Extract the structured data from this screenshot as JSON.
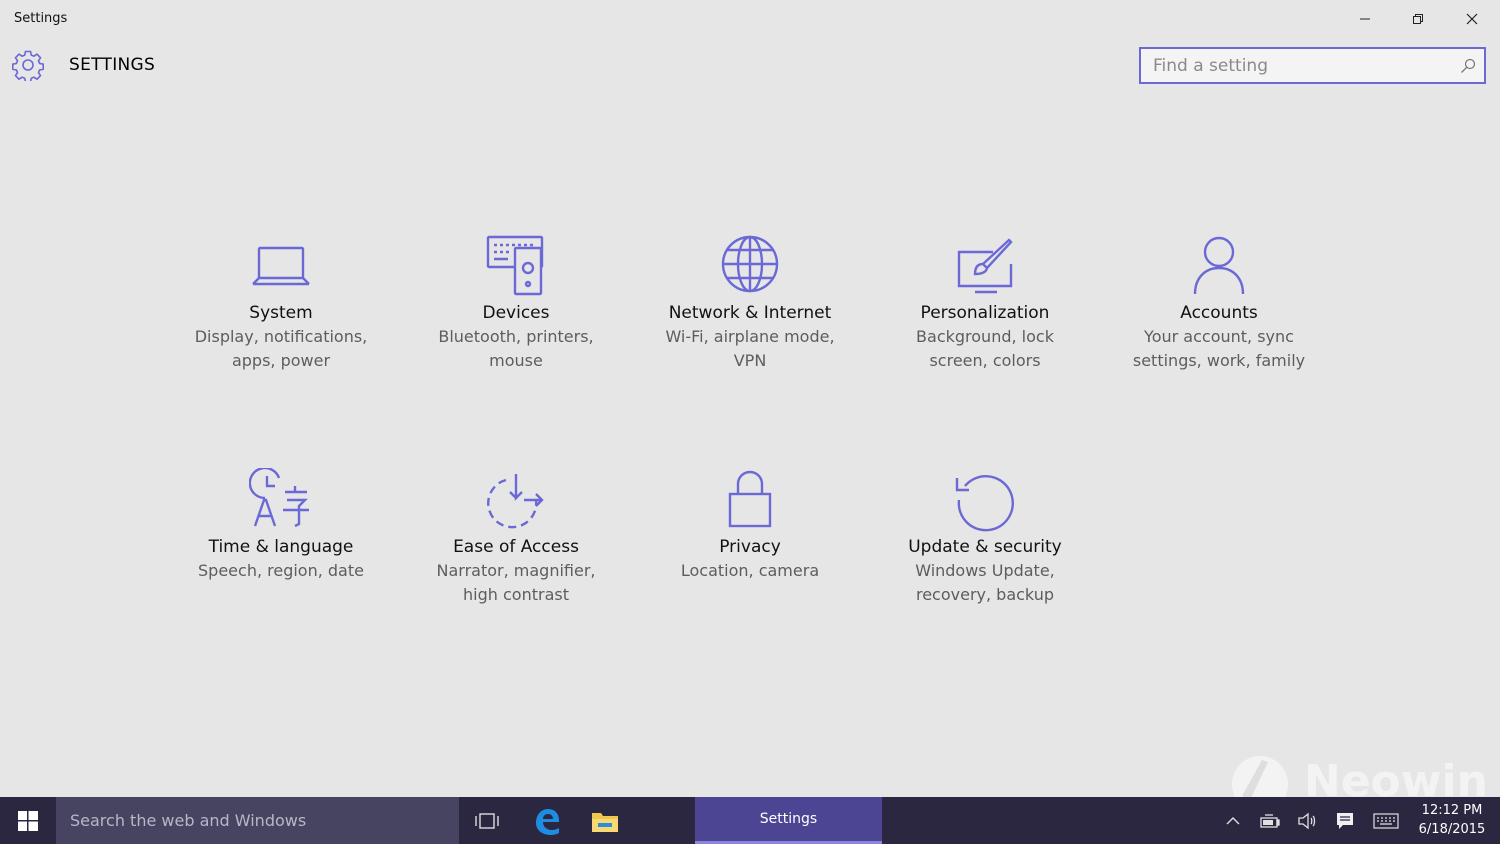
{
  "window": {
    "title": "Settings"
  },
  "header": {
    "title": "SETTINGS",
    "search_placeholder": "Find a setting"
  },
  "tiles": [
    {
      "title": "System",
      "desc": "Display, notifications, apps, power",
      "icon": "laptop-icon"
    },
    {
      "title": "Devices",
      "desc": "Bluetooth, printers, mouse",
      "icon": "devices-icon"
    },
    {
      "title": "Network & Internet",
      "desc": "Wi-Fi, airplane mode, VPN",
      "icon": "globe-icon"
    },
    {
      "title": "Personalization",
      "desc": "Background, lock screen, colors",
      "icon": "paintbrush-icon"
    },
    {
      "title": "Accounts",
      "desc": "Your account, sync settings, work, family",
      "icon": "person-icon"
    },
    {
      "title": "Time & language",
      "desc": "Speech, region, date",
      "icon": "time-language-icon"
    },
    {
      "title": "Ease of Access",
      "desc": "Narrator, magnifier, high contrast",
      "icon": "ease-of-access-icon"
    },
    {
      "title": "Privacy",
      "desc": "Location, camera",
      "icon": "lock-icon"
    },
    {
      "title": "Update & security",
      "desc": "Windows Update, recovery, backup",
      "icon": "update-icon"
    }
  ],
  "taskbar": {
    "search_placeholder": "Search the web and Windows",
    "active_app": "Settings",
    "time": "12:12 PM",
    "date": "6/18/2015"
  },
  "watermark": "Neowin",
  "colors": {
    "accent": "#6b69d6",
    "background": "#e6e6e6",
    "taskbar": "#2b2740",
    "taskbar_search": "#474461",
    "active_app": "#4b4593"
  }
}
